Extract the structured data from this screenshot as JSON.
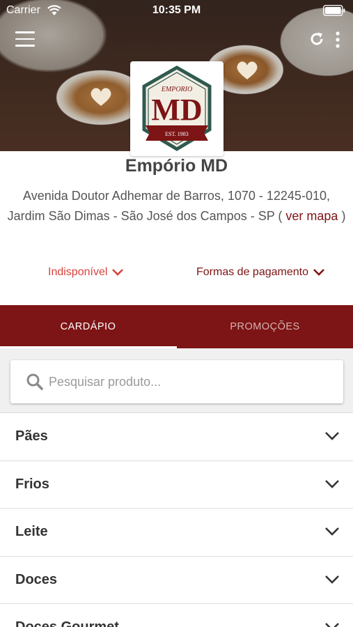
{
  "status_bar": {
    "carrier": "Carrier",
    "time": "10:35 PM"
  },
  "toolbar": {
    "menu_icon": "hamburger-menu",
    "refresh_icon": "refresh",
    "more_icon": "vertical-dots"
  },
  "store": {
    "logo": {
      "top_text": "EMPORIO",
      "initials": "MD",
      "ribbon_text": "EST. 1983"
    },
    "name": "Empório MD",
    "address": "Avenida Doutor Adhemar de Barros, 1070 - 12245-010, Jardim São Dimas - São José dos Campos - SP",
    "map_link_open": " ( ",
    "map_link_text": "ver mapa",
    "map_link_close": " )",
    "status_label": "Indisponível",
    "payment_label": "Formas de pagamento"
  },
  "tabs": [
    {
      "label": "CARDÁPIO",
      "active": true
    },
    {
      "label": "PROMOÇÕES",
      "active": false
    }
  ],
  "search": {
    "placeholder": "Pesquisar produto...",
    "value": ""
  },
  "categories": [
    {
      "label": "Pães"
    },
    {
      "label": "Frios"
    },
    {
      "label": "Leite"
    },
    {
      "label": "Doces"
    },
    {
      "label": "Doces Gourmet"
    }
  ],
  "colors": {
    "brand": "#7d1415",
    "unavailable": "#d9423c",
    "logo_green": "#2f5a4f"
  }
}
